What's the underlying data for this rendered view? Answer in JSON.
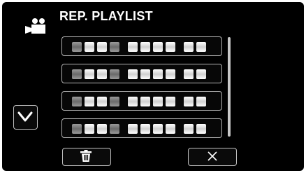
{
  "header": {
    "title": "REP. PLAYLIST",
    "mode_icon": "video-camera-icon"
  },
  "playlist": {
    "items": [
      {
        "label": ""
      },
      {
        "label": ""
      },
      {
        "label": ""
      },
      {
        "label": ""
      }
    ]
  },
  "controls": {
    "scroll_icon": "chevron-down-icon",
    "delete_icon": "trash-icon",
    "close_icon": "close-icon"
  },
  "colors": {
    "background": "#000000",
    "border": "#b3b3b3",
    "text": "#ffffff"
  }
}
